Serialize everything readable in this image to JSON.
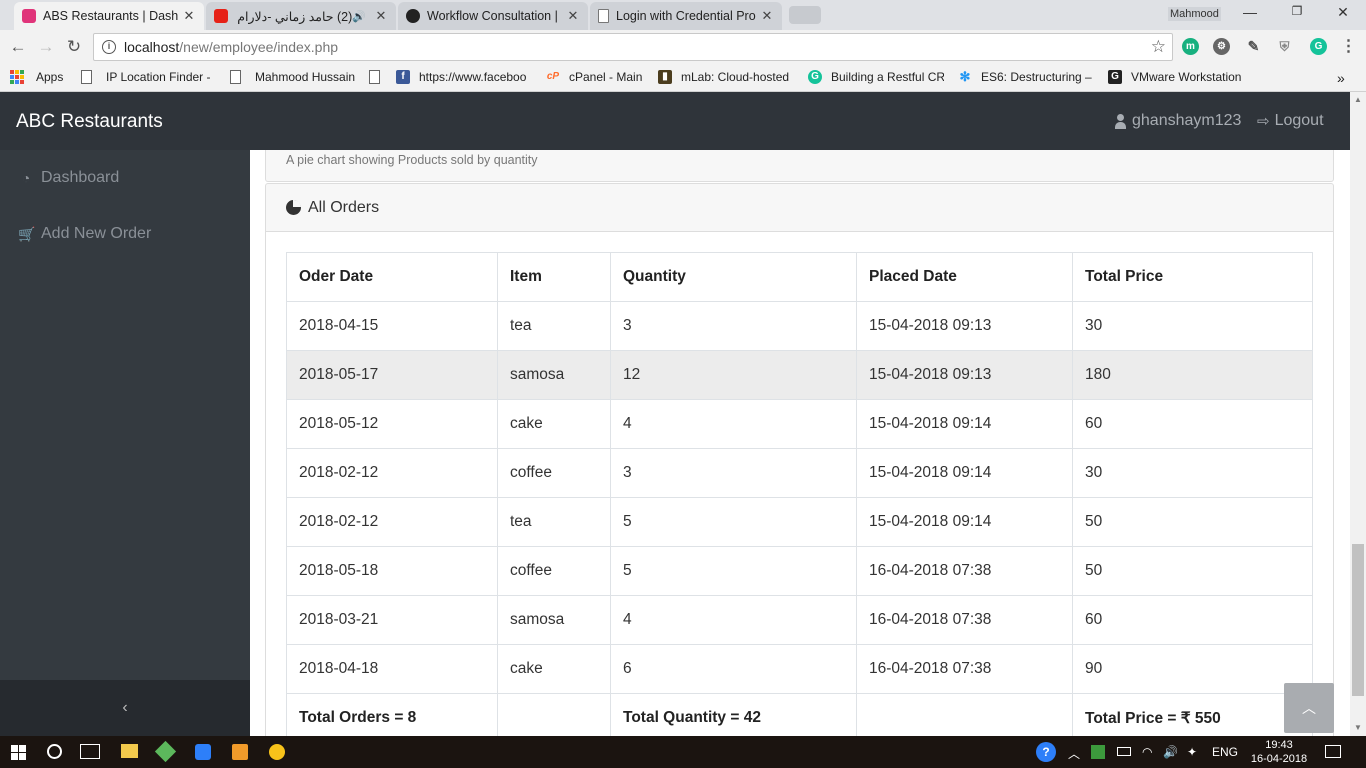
{
  "browser": {
    "tabs": [
      {
        "label": "ABS Restaurants | Dashbo",
        "close": "✕"
      },
      {
        "label": "(2) حامد زماني -دلارام",
        "close": "✕"
      },
      {
        "label": "Workflow Consultation | G",
        "close": "✕"
      },
      {
        "label": "Login with Credential Pro",
        "close": "✕"
      }
    ],
    "profile_name": "Mahmood",
    "url_host": "localhost",
    "url_path": "/new/employee/index.php",
    "bookmarks": [
      {
        "label": "Apps"
      },
      {
        "label": "IP Location Finder - G"
      },
      {
        "label": "Mahmood Hussain"
      },
      {
        "label": "https://www.faceboo"
      },
      {
        "label": "cPanel - Main"
      },
      {
        "label": "mLab: Cloud-hosted"
      },
      {
        "label": "Building a Restful CR"
      },
      {
        "label": "ES6: Destructuring –"
      },
      {
        "label": "VMware Workstation"
      }
    ],
    "overflow": "»"
  },
  "app": {
    "brand": "ABC Restaurants",
    "username": "ghanshaym123",
    "logout": "Logout",
    "sidebar": [
      {
        "label": "Dashboard",
        "icon": "dashboard-icon"
      },
      {
        "label": "Add New Order",
        "icon": "cart-icon"
      }
    ],
    "sidebar_toggle": "‹"
  },
  "main": {
    "chart_caption": "A pie chart showing Products sold by quantity",
    "card_title": "All Orders",
    "table": {
      "headers": [
        "Oder Date",
        "Item",
        "Quantity",
        "Placed Date",
        "Total Price"
      ],
      "rows": [
        [
          "2018-04-15",
          "tea",
          "3",
          "15-04-2018 09:13",
          "30"
        ],
        [
          "2018-05-17",
          "samosa",
          "12",
          "15-04-2018 09:13",
          "180"
        ],
        [
          "2018-05-12",
          "cake",
          "4",
          "15-04-2018 09:14",
          "60"
        ],
        [
          "2018-02-12",
          "coffee",
          "3",
          "15-04-2018 09:14",
          "30"
        ],
        [
          "2018-02-12",
          "tea",
          "5",
          "15-04-2018 09:14",
          "50"
        ],
        [
          "2018-05-18",
          "coffee",
          "5",
          "16-04-2018 07:38",
          "50"
        ],
        [
          "2018-03-21",
          "samosa",
          "4",
          "16-04-2018 07:38",
          "60"
        ],
        [
          "2018-04-18",
          "cake",
          "6",
          "16-04-2018 07:38",
          "90"
        ]
      ],
      "totals": [
        "Total Orders = 8",
        "",
        "Total Quantity = 42",
        "",
        "Total Price = ₹ 550"
      ]
    }
  },
  "taskbar": {
    "language": "ENG",
    "time": "19:43",
    "date": "16-04-2018"
  },
  "colors": {
    "navbar": "#2f343a",
    "sidebar": "#343a40",
    "striped_row": "#ececec"
  }
}
